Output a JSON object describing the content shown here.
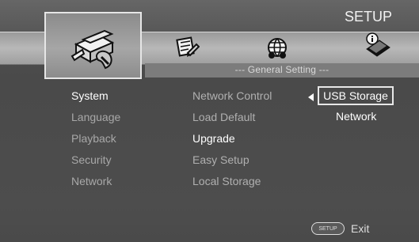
{
  "header": {
    "title": "SETUP"
  },
  "tabs": [
    {
      "name": "system-tools-icon"
    },
    {
      "name": "pencil-icon"
    },
    {
      "name": "globe-icon"
    },
    {
      "name": "info-icon"
    }
  ],
  "section": {
    "title": "--- General Setting ---"
  },
  "menu": {
    "items": [
      {
        "label": "System"
      },
      {
        "label": "Language"
      },
      {
        "label": "Playback"
      },
      {
        "label": "Security"
      },
      {
        "label": "Network"
      }
    ]
  },
  "submenu": {
    "items": [
      {
        "label": "Network Control"
      },
      {
        "label": "Load Default"
      },
      {
        "label": "Upgrade"
      },
      {
        "label": "Easy Setup"
      },
      {
        "label": "Local Storage"
      }
    ]
  },
  "options": {
    "selected": "USB Storage",
    "other": "Network"
  },
  "footer": {
    "button_text": "SETUP",
    "exit_label": "Exit"
  }
}
